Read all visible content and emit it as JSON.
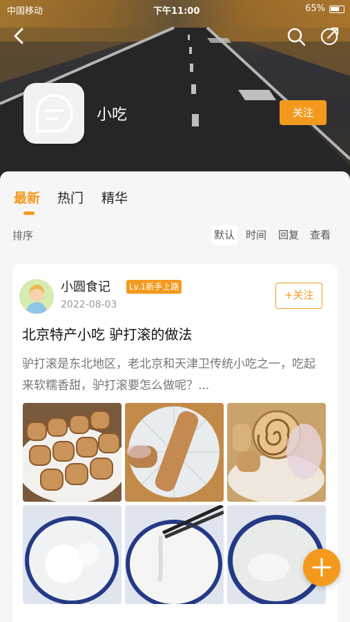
{
  "status_bar": {
    "carrier": "中国移动",
    "time": "下午11:00",
    "battery": "65%"
  },
  "header": {
    "group_name": "小吃",
    "follow_label": "关注"
  },
  "tabs": [
    {
      "label": "最新",
      "active": true
    },
    {
      "label": "热门",
      "active": false
    },
    {
      "label": "精华",
      "active": false
    }
  ],
  "sort": {
    "label": "排序",
    "options": [
      {
        "label": "默认",
        "active": true
      },
      {
        "label": "时间",
        "active": false
      },
      {
        "label": "回复",
        "active": false
      },
      {
        "label": "查看",
        "active": false
      }
    ]
  },
  "post": {
    "author": "小圆食记",
    "level_badge": "Lv.1新手上路",
    "date": "2022-08-03",
    "follow_label": "+关注",
    "title": "北京特产小吃 驴打滚的做法",
    "excerpt": "驴打滚是东北地区，老北京和天津卫传统小吃之一，吃起来软糯香甜，驴打滚要怎么做呢？..."
  },
  "colors": {
    "accent": "#f39a1e"
  },
  "icons": [
    "back-icon",
    "search-icon",
    "share-icon",
    "chat-bubble-icon",
    "plus-icon"
  ]
}
